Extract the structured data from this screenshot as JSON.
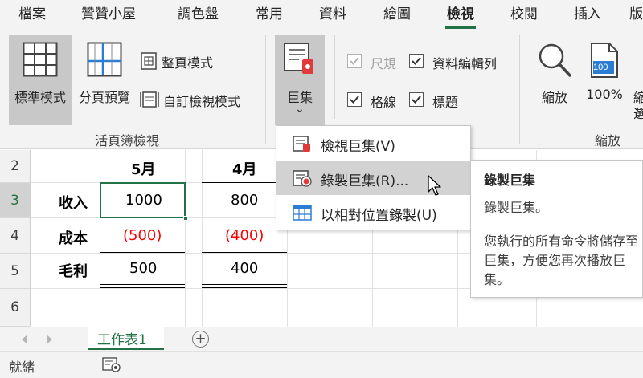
{
  "tabs": [
    "檔案",
    "贊贊小屋",
    "調色盤",
    "常用",
    "資料",
    "繪圖",
    "檢視",
    "校閱",
    "插入",
    "版"
  ],
  "active_tab": "檢視",
  "ribbon": {
    "workbook_views": {
      "normal": "標準模式",
      "page_break": "分頁預覽",
      "page_layout": "整頁模式",
      "custom_views": "自訂檢視模式",
      "group_label": "活頁簿檢視"
    },
    "macros": {
      "label": "巨集",
      "arrow": "⌄"
    },
    "show": {
      "ruler": "尺規",
      "formula_bar": "資料編輯列",
      "gridlines": "格線",
      "headings": "標題"
    },
    "zoom": {
      "zoom": "縮放",
      "zoom100": "100%",
      "zoom100_icon_text": "100",
      "selection_fragment_1": "縮",
      "selection_fragment_2": "選",
      "group_label": "縮放"
    }
  },
  "menu": {
    "view_macros": "檢視巨集(V)",
    "record_macro": "錄製巨集(R)...",
    "relative_record": "以相對位置錄製(U)"
  },
  "tooltip": {
    "title": "錄製巨集",
    "line1": "錄製巨集。",
    "body": "您執行的所有命令將儲存至巨集，方便您再次播放巨集。"
  },
  "grid": {
    "row_numbers": [
      "2",
      "3",
      "4",
      "5",
      "6"
    ],
    "header_may": "5月",
    "header_apr": "4月",
    "rows": [
      {
        "label": "收入",
        "may": "1000",
        "apr": "800"
      },
      {
        "label": "成本",
        "may": "(500)",
        "apr": "(400)"
      },
      {
        "label": "毛利",
        "may": "500",
        "apr": "400"
      }
    ]
  },
  "sheet": {
    "name": "工作表1",
    "add": "+"
  },
  "status": {
    "ready": "就緒"
  },
  "colors": {
    "accent": "#217346",
    "negative": "#ff0000",
    "record_red": "#e03a3a"
  }
}
